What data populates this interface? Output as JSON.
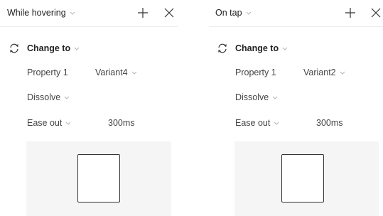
{
  "panels": [
    {
      "trigger_label": "While hovering",
      "action_label": "Change to",
      "property_name": "Property 1",
      "property_value": "Variant4",
      "animation": "Dissolve",
      "easing": "Ease out",
      "duration": "300ms"
    },
    {
      "trigger_label": "On tap",
      "action_label": "Change to",
      "property_name": "Property 1",
      "property_value": "Variant2",
      "animation": "Dissolve",
      "easing": "Ease out",
      "duration": "300ms"
    }
  ],
  "icons": {
    "add": "plus-icon",
    "close": "close-icon",
    "action": "swap-icon",
    "dropdown": "chevron-down-icon"
  }
}
